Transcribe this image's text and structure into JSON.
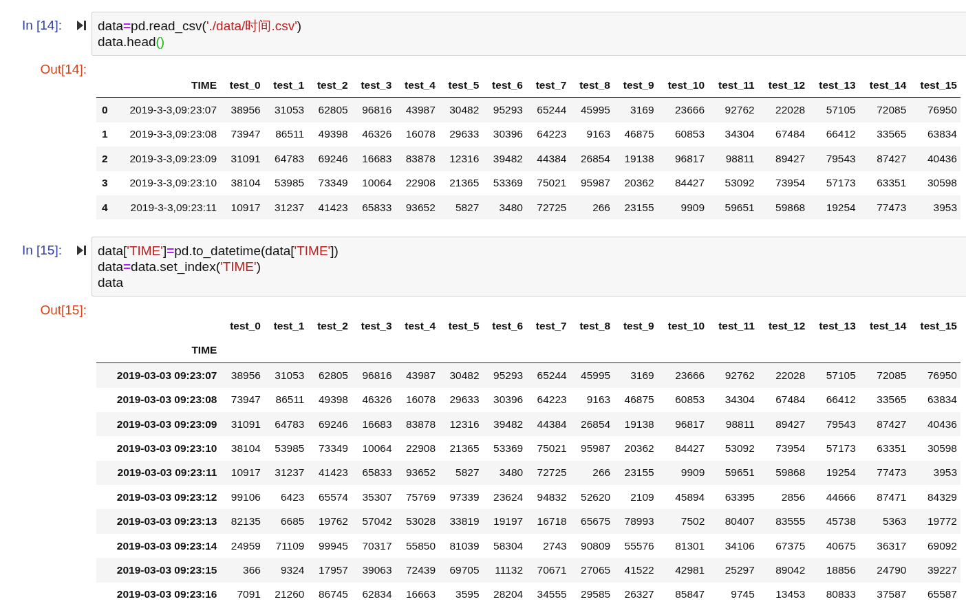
{
  "cells": [
    {
      "prompt": "In [14]:",
      "code": [
        [
          {
            "kind": "name",
            "text": "data"
          },
          {
            "kind": "op",
            "text": "="
          },
          {
            "kind": "name",
            "text": "pd.read_csv("
          },
          {
            "kind": "string",
            "text": "'./data/时间.csv'"
          },
          {
            "kind": "name",
            "text": ")"
          }
        ],
        [
          {
            "kind": "name",
            "text": "data.head"
          },
          {
            "kind": "bracket",
            "text": "()"
          }
        ]
      ],
      "out_prompt": "Out[14]:",
      "table": {
        "columns": [
          "TIME",
          "test_0",
          "test_1",
          "test_2",
          "test_3",
          "test_4",
          "test_5",
          "test_6",
          "test_7",
          "test_8",
          "test_9",
          "test_10",
          "test_11",
          "test_12",
          "test_13",
          "test_14",
          "test_15"
        ],
        "rows": [
          {
            "index": "0",
            "values": [
              "2019-3-3,09:23:07",
              "38956",
              "31053",
              "62805",
              "96816",
              "43987",
              "30482",
              "95293",
              "65244",
              "45995",
              "3169",
              "23666",
              "92762",
              "22028",
              "57105",
              "72085",
              "76950"
            ]
          },
          {
            "index": "1",
            "values": [
              "2019-3-3,09:23:08",
              "73947",
              "86511",
              "49398",
              "46326",
              "16078",
              "29633",
              "30396",
              "64223",
              "9163",
              "46875",
              "60853",
              "34304",
              "67484",
              "66412",
              "33565",
              "63834"
            ]
          },
          {
            "index": "2",
            "values": [
              "2019-3-3,09:23:09",
              "31091",
              "64783",
              "69246",
              "16683",
              "83878",
              "12316",
              "39482",
              "44384",
              "26854",
              "19138",
              "96817",
              "98811",
              "89427",
              "79543",
              "87427",
              "40436"
            ]
          },
          {
            "index": "3",
            "values": [
              "2019-3-3,09:23:10",
              "38104",
              "53985",
              "73349",
              "10064",
              "22908",
              "21365",
              "53369",
              "75021",
              "95987",
              "20362",
              "84427",
              "53092",
              "73954",
              "57173",
              "63351",
              "30598"
            ]
          },
          {
            "index": "4",
            "values": [
              "2019-3-3,09:23:11",
              "10917",
              "31237",
              "41423",
              "65833",
              "93652",
              "5827",
              "3480",
              "72725",
              "266",
              "23155",
              "9909",
              "59651",
              "59868",
              "19254",
              "77473",
              "3953"
            ]
          }
        ]
      }
    },
    {
      "prompt": "In [15]:",
      "code": [
        [
          {
            "kind": "name",
            "text": "data["
          },
          {
            "kind": "string",
            "text": "'TIME'"
          },
          {
            "kind": "name",
            "text": "]"
          },
          {
            "kind": "op",
            "text": "="
          },
          {
            "kind": "name",
            "text": "pd.to_datetime(data["
          },
          {
            "kind": "string",
            "text": "'TIME'"
          },
          {
            "kind": "name",
            "text": "])"
          }
        ],
        [
          {
            "kind": "name",
            "text": "data"
          },
          {
            "kind": "op",
            "text": "="
          },
          {
            "kind": "name",
            "text": "data.set_index("
          },
          {
            "kind": "string",
            "text": "'TIME'"
          },
          {
            "kind": "name",
            "text": ")"
          }
        ],
        [
          {
            "kind": "name",
            "text": "data"
          }
        ]
      ],
      "out_prompt": "Out[15]:",
      "table": {
        "columns": [
          "test_0",
          "test_1",
          "test_2",
          "test_3",
          "test_4",
          "test_5",
          "test_6",
          "test_7",
          "test_8",
          "test_9",
          "test_10",
          "test_11",
          "test_12",
          "test_13",
          "test_14",
          "test_15"
        ],
        "index_name": "TIME",
        "rows": [
          {
            "index": "2019-03-03 09:23:07",
            "values": [
              "38956",
              "31053",
              "62805",
              "96816",
              "43987",
              "30482",
              "95293",
              "65244",
              "45995",
              "3169",
              "23666",
              "92762",
              "22028",
              "57105",
              "72085",
              "76950"
            ]
          },
          {
            "index": "2019-03-03 09:23:08",
            "values": [
              "73947",
              "86511",
              "49398",
              "46326",
              "16078",
              "29633",
              "30396",
              "64223",
              "9163",
              "46875",
              "60853",
              "34304",
              "67484",
              "66412",
              "33565",
              "63834"
            ]
          },
          {
            "index": "2019-03-03 09:23:09",
            "values": [
              "31091",
              "64783",
              "69246",
              "16683",
              "83878",
              "12316",
              "39482",
              "44384",
              "26854",
              "19138",
              "96817",
              "98811",
              "89427",
              "79543",
              "87427",
              "40436"
            ]
          },
          {
            "index": "2019-03-03 09:23:10",
            "values": [
              "38104",
              "53985",
              "73349",
              "10064",
              "22908",
              "21365",
              "53369",
              "75021",
              "95987",
              "20362",
              "84427",
              "53092",
              "73954",
              "57173",
              "63351",
              "30598"
            ]
          },
          {
            "index": "2019-03-03 09:23:11",
            "values": [
              "10917",
              "31237",
              "41423",
              "65833",
              "93652",
              "5827",
              "3480",
              "72725",
              "266",
              "23155",
              "9909",
              "59651",
              "59868",
              "19254",
              "77473",
              "3953"
            ]
          },
          {
            "index": "2019-03-03 09:23:12",
            "values": [
              "99106",
              "6423",
              "65574",
              "35307",
              "75769",
              "97339",
              "23624",
              "94832",
              "52620",
              "2109",
              "45894",
              "63395",
              "2856",
              "44666",
              "87471",
              "84329"
            ]
          },
          {
            "index": "2019-03-03 09:23:13",
            "values": [
              "82135",
              "6685",
              "19762",
              "57042",
              "53028",
              "33819",
              "19197",
              "16718",
              "65675",
              "78993",
              "7502",
              "80407",
              "83555",
              "45738",
              "5363",
              "19772"
            ]
          },
          {
            "index": "2019-03-03 09:23:14",
            "values": [
              "24959",
              "71109",
              "99945",
              "70317",
              "55850",
              "81039",
              "58304",
              "2743",
              "90809",
              "55576",
              "81301",
              "34106",
              "67375",
              "40675",
              "36317",
              "69092"
            ]
          },
          {
            "index": "2019-03-03 09:23:15",
            "values": [
              "366",
              "9324",
              "17957",
              "39063",
              "72439",
              "69705",
              "11132",
              "70671",
              "27065",
              "41522",
              "42981",
              "25297",
              "89042",
              "18856",
              "24790",
              "39227"
            ]
          },
          {
            "index": "2019-03-03 09:23:16",
            "values": [
              "7091",
              "21260",
              "86745",
              "62834",
              "16663",
              "3595",
              "28204",
              "34555",
              "29585",
              "26327",
              "85847",
              "9745",
              "13453",
              "80833",
              "37587",
              "65587"
            ]
          }
        ]
      }
    }
  ]
}
